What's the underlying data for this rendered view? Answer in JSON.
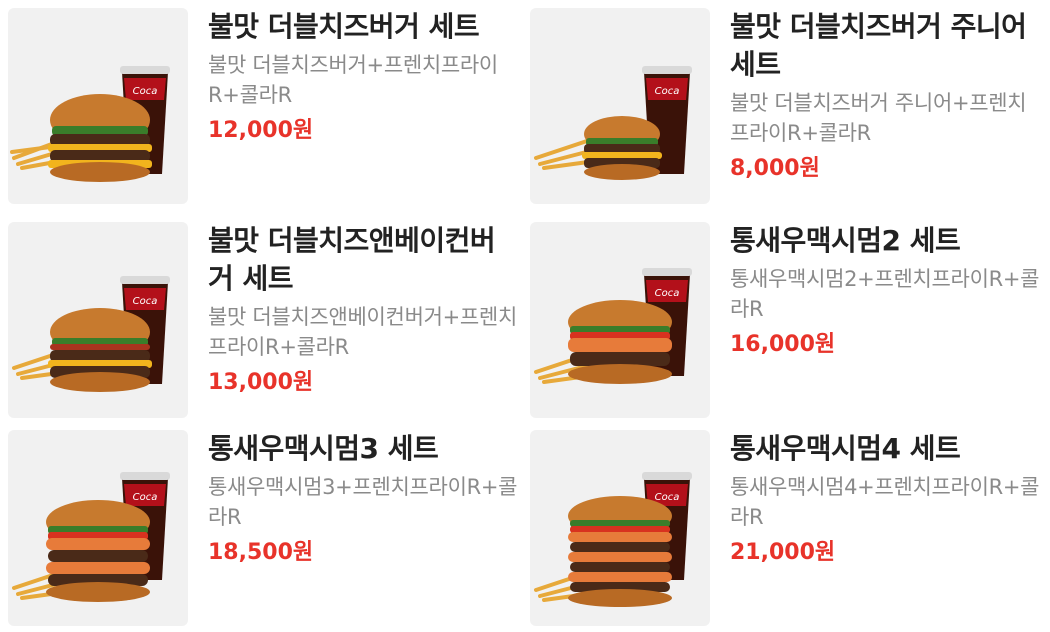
{
  "accent_color": "#e8332a",
  "menu": {
    "items": [
      {
        "name": "불맛 더블치즈버거 세트",
        "description": "불맛 더블치즈버거+프렌치프라이R+콜라R",
        "price": "12,000원",
        "burger": "double-cheeseburger",
        "image_icon": "double-cheeseburger-set-image"
      },
      {
        "name": "불맛 더블치즈버거 주니어 세트",
        "description": "불맛 더블치즈버거 주니어+프렌치프라이R+콜라R",
        "price": "8,000원",
        "burger": "double-cheeseburger-junior",
        "image_icon": "double-cheeseburger-junior-set-image"
      },
      {
        "name": "불맛 더블치즈앤베이컨버거 세트",
        "description": "불맛 더블치즈앤베이컨버거+프렌치프라이R+콜라R",
        "price": "13,000원",
        "burger": "double-cheese-bacon-burger",
        "image_icon": "double-cheese-bacon-burger-set-image"
      },
      {
        "name": "통새우맥시멈2 세트",
        "description": "통새우맥시멈2+프렌치프라이R+콜라R",
        "price": "16,000원",
        "burger": "shrimp-maximum-2",
        "image_icon": "shrimp-maximum-2-set-image"
      },
      {
        "name": "통새우맥시멈3 세트",
        "description": "통새우맥시멈3+프렌치프라이R+콜라R",
        "price": "18,500원",
        "burger": "shrimp-maximum-3",
        "image_icon": "shrimp-maximum-3-set-image"
      },
      {
        "name": "통새우맥시멈4 세트",
        "description": "통새우맥시멈4+프렌치프라이R+콜라R",
        "price": "21,000원",
        "burger": "shrimp-maximum-4",
        "image_icon": "shrimp-maximum-4-set-image"
      }
    ]
  }
}
